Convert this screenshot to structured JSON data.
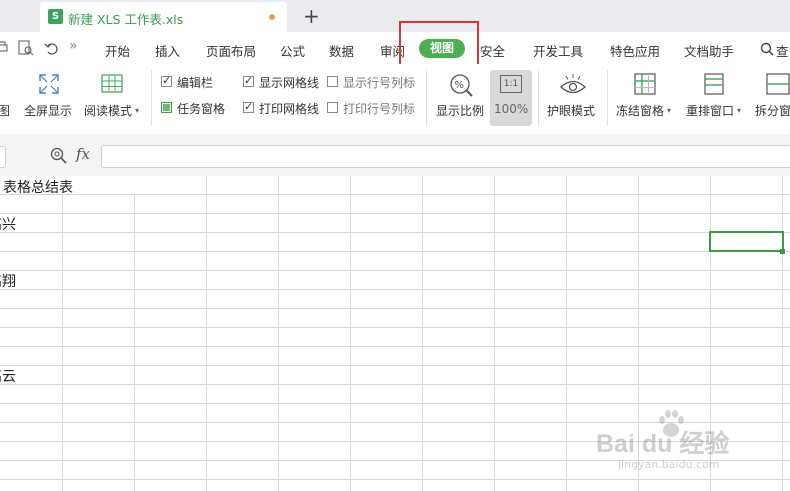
{
  "window": {
    "tab_icon_letter": "S",
    "tab_title": "新建 XLS 工作表.xls",
    "new_tab_symbol": "+"
  },
  "menu": {
    "quick_access_more": "»",
    "items": [
      "开始",
      "插入",
      "页面布局",
      "公式",
      "数据",
      "审阅",
      "视图",
      "安全",
      "开发工具",
      "特色应用",
      "文档助手",
      "查"
    ],
    "active": "视图"
  },
  "ribbon": {
    "partial_left_label": "图",
    "fullscreen_label": "全屏显示",
    "read_mode_label": "阅读模式",
    "checkboxes": {
      "edit_bar": {
        "label": "编辑栏",
        "checked": true
      },
      "task_pane": {
        "label": "任务窗格",
        "checked": true
      },
      "show_gridlines": {
        "label": "显示网格线",
        "checked": true
      },
      "print_gridlines": {
        "label": "打印网格线",
        "checked": true
      },
      "show_row_col_headers": {
        "label": "显示行号列标",
        "checked": false
      },
      "print_row_col_headers": {
        "label": "打印行号列标",
        "checked": false
      }
    },
    "zoom_label": "显示比例",
    "zoom_100_label": "100%",
    "zoom_100_icon_text": "1:1",
    "eye_protect_label": "护眼模式",
    "freeze_label": "冻结窗格",
    "rearrange_label": "重排窗口",
    "split_label": "拆分窗"
  },
  "formula_bar": {
    "fx_label": "fx",
    "value": ""
  },
  "sheet": {
    "cells": [
      {
        "text": "表格总结表"
      },
      {
        "text": "高兴"
      },
      {
        "text": "高翔"
      },
      {
        "text": "高云"
      }
    ]
  },
  "watermark": {
    "text": "Bai du 经验",
    "sub": "jingyan.baidu.com"
  },
  "colors": {
    "accent_green": "#4cae4f",
    "highlight_red": "#e03030",
    "selection_green": "#3a9a46"
  }
}
